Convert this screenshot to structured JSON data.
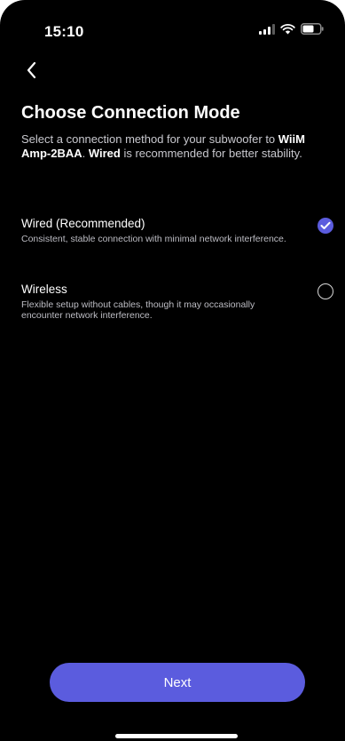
{
  "status_bar": {
    "time": "15:10",
    "icons": [
      "signal-icon",
      "wifi-icon",
      "battery-icon"
    ]
  },
  "navigation": {
    "back_icon": "chevron-left-icon"
  },
  "header": {
    "title": "Choose Connection Mode",
    "description_parts": {
      "p1": "Select a connection method for your subwoofer to ",
      "device": "WiiM Amp-2BAA",
      "p2": ". ",
      "recommended": "Wired",
      "p3": " is recommended for better stability."
    }
  },
  "options": [
    {
      "label": "Wired (Recommended)",
      "description": "Consistent, stable connection with minimal network interference.",
      "selected": true
    },
    {
      "label": "Wireless",
      "description": "Flexible setup without cables, though it may occasionally encounter network interference.",
      "selected": false
    }
  ],
  "footer": {
    "next_label": "Next"
  },
  "colors": {
    "accent": "#5b5cde",
    "background": "#000000",
    "text": "#ffffff",
    "secondary_text": "#bdbdc4"
  }
}
